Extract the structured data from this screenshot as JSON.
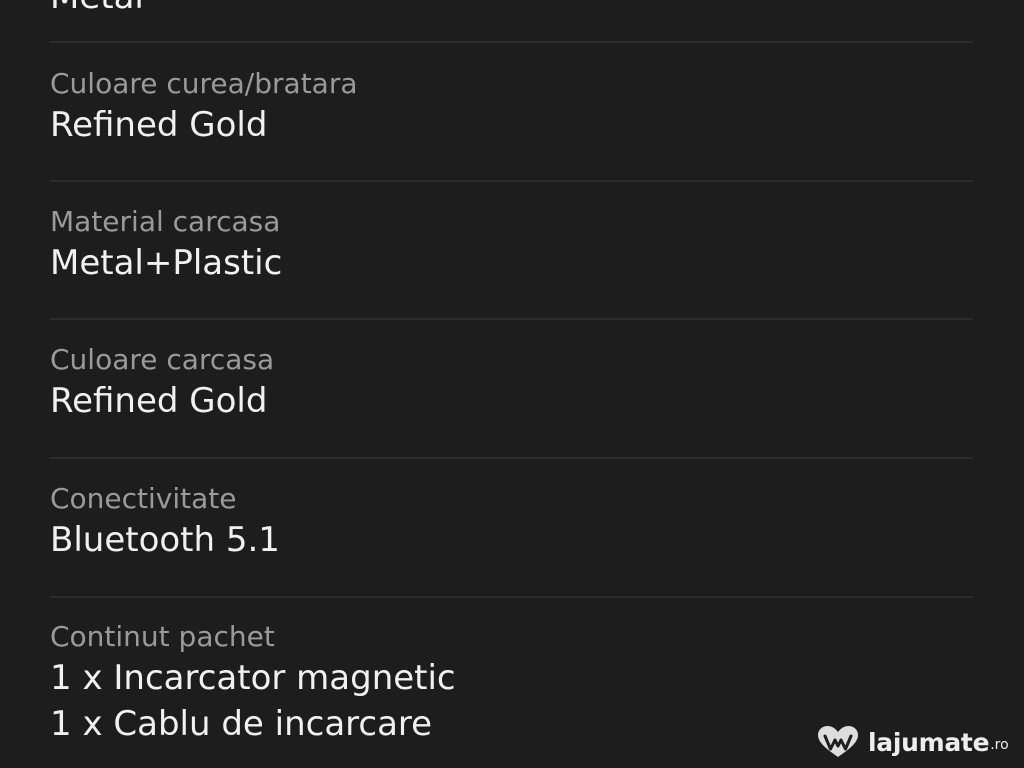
{
  "specs": [
    {
      "label": "",
      "value": "Metal"
    },
    {
      "label": "Culoare curea/bratara",
      "value": "Refined Gold"
    },
    {
      "label": "Material carcasa",
      "value": "Metal+Plastic"
    },
    {
      "label": "Culoare carcasa",
      "value": "Refined Gold"
    },
    {
      "label": "Conectivitate",
      "value": "Bluetooth 5.1"
    },
    {
      "label": "Continut pachet",
      "values": [
        "1 x Incarcator magnetic",
        "1 x Cablu de incarcare"
      ]
    }
  ],
  "watermark": {
    "name": "lajumate",
    "tld": ".ro",
    "icon": "heart-w-icon"
  },
  "colors": {
    "background": "#1d1d1d",
    "label": "#9a9a9a",
    "value": "#f1f1f1",
    "divider": "#2c2c2c"
  }
}
